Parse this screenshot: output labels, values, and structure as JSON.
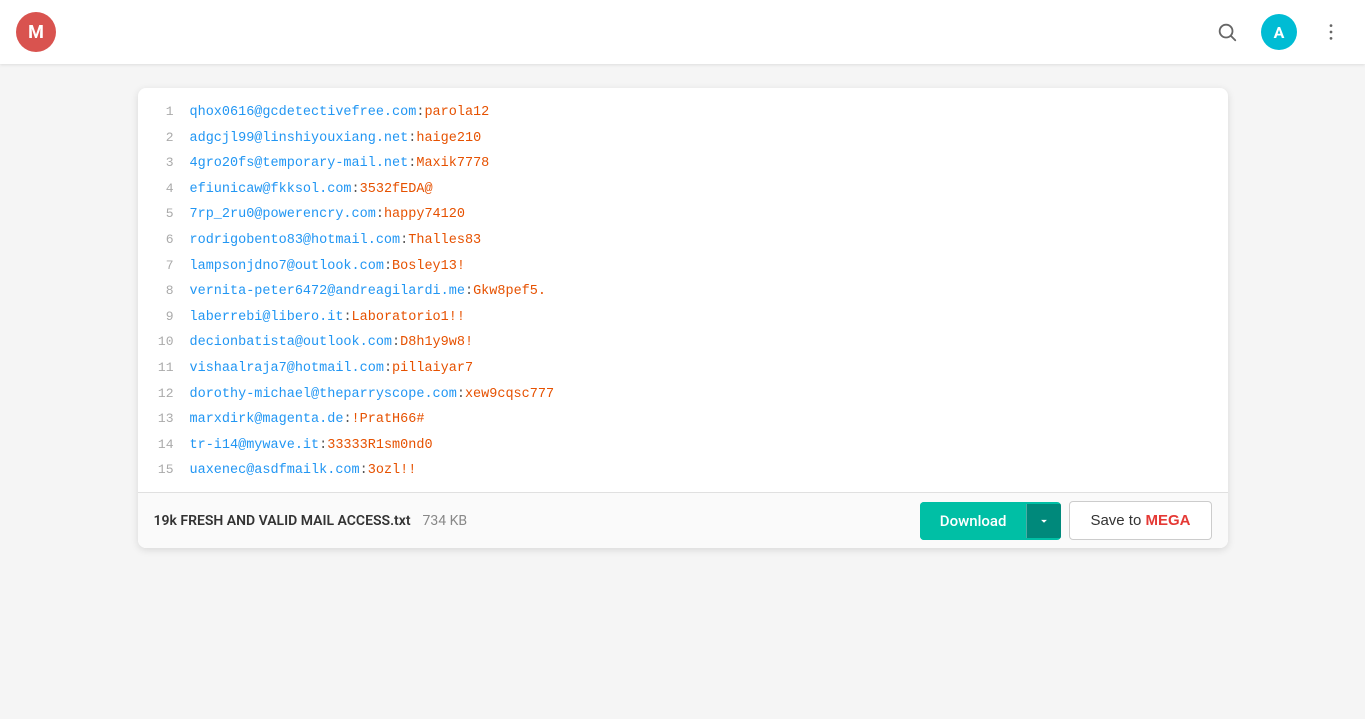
{
  "app": {
    "logo_letter": "M",
    "logo_color": "#d9534f"
  },
  "nav": {
    "search_icon": "search",
    "avatar_letter": "A",
    "avatar_color": "#00bcd4",
    "more_icon": "more-vertical"
  },
  "file": {
    "name": "19k FRESH AND VALID MAIL ACCESS.txt",
    "size": "734 KB",
    "lines": [
      {
        "num": "1",
        "email": "qhox0616@gcdetectivefree.com",
        "sep": ":",
        "pass": "parola12"
      },
      {
        "num": "2",
        "email": "adgcjl99@linshiyouxiang.net",
        "sep": ":",
        "pass": "haige210"
      },
      {
        "num": "3",
        "email": "4gro20fs@temporary-mail.net",
        "sep": ":",
        "pass": "Maxik7778"
      },
      {
        "num": "4",
        "email": "efiunicaw@fkksol.com",
        "sep": ":",
        "pass": "3532fEDA@"
      },
      {
        "num": "5",
        "email": "7rp_2ru0@powerencry.com",
        "sep": ":",
        "pass": "happy74120"
      },
      {
        "num": "6",
        "email": "rodrigobento83@hotmail.com",
        "sep": ":",
        "pass": "Thalles83"
      },
      {
        "num": "7",
        "email": "lampsonjdno7@outlook.com",
        "sep": ":",
        "pass": "Bosley13!"
      },
      {
        "num": "8",
        "email": "vernita-peter6472@andreagilardi.me",
        "sep": ":",
        "pass": "Gkw8pef5."
      },
      {
        "num": "9",
        "email": "laberrebi@libero.it",
        "sep": ":",
        "pass": "Laboratorio1!!"
      },
      {
        "num": "10",
        "email": "decionbatista@outlook.com",
        "sep": ":",
        "pass": "D8h1y9w8!"
      },
      {
        "num": "11",
        "email": "vishaalraja7@hotmail.com",
        "sep": ":",
        "pass": "pillaiyar7"
      },
      {
        "num": "12",
        "email": "dorothy-michael@theparryscope.com",
        "sep": ":",
        "pass": "xew9cqsc777"
      },
      {
        "num": "13",
        "email": "marxdirk@magenta.de",
        "sep": ":",
        "pass": "!PratH66#"
      },
      {
        "num": "14",
        "email": "tr-i14@mywave.it",
        "sep": ":",
        "pass": "33333R1sm0nd0"
      },
      {
        "num": "15",
        "email": "uaxenec@asdfmailk.com",
        "sep": ":",
        "pass": "3ozl!!"
      }
    ]
  },
  "buttons": {
    "download": "Download",
    "save_to_mega_prefix": "Save to ",
    "save_to_mega_brand": "MEGA"
  }
}
